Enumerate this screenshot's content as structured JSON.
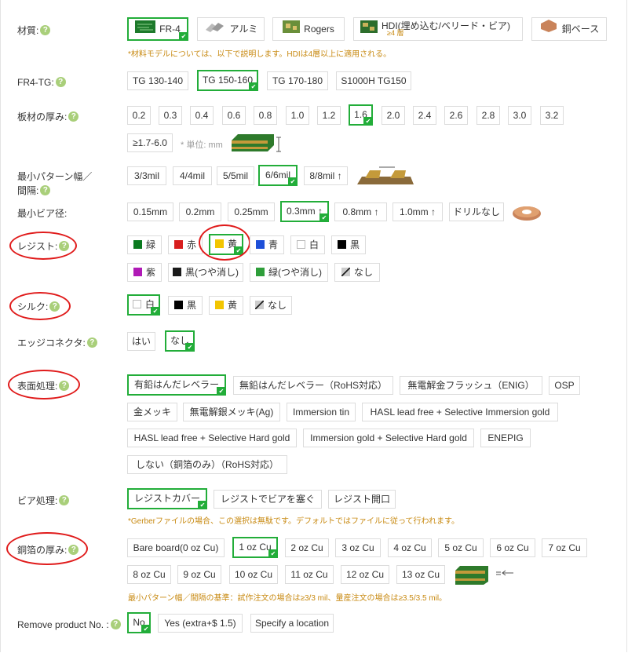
{
  "material": {
    "label": "材質:",
    "options": [
      "FR-4",
      "アルミ",
      "Rogers",
      "HDI(埋め込む/ベリード・ビア)",
      "銅ベース"
    ],
    "hdi_sub": "≥4 層",
    "selected": "FR-4",
    "note": "*材料モデルについては、以下で説明します。HDIは4層以上に適用される。"
  },
  "tg": {
    "label": "FR4-TG:",
    "options": [
      "TG 130-140",
      "TG 150-160",
      "TG 170-180",
      "S1000H TG150"
    ],
    "selected": "TG 150-160"
  },
  "thickness": {
    "label": "板材の厚み:",
    "options": [
      "0.2",
      "0.3",
      "0.4",
      "0.6",
      "0.8",
      "1.0",
      "1.2",
      "1.6",
      "2.0",
      "2.4",
      "2.6",
      "2.8",
      "3.0",
      "3.2",
      "≥1.7-6.0"
    ],
    "selected": "1.6",
    "unit": "* 単位: mm"
  },
  "pattern": {
    "label_line1": "最小パターン幅／",
    "label_line2": "間隔:",
    "options": [
      "3/3mil",
      "4/4mil",
      "5/5mil",
      "6/6mil",
      "8/8mil ↑"
    ],
    "selected": "6/6mil"
  },
  "via": {
    "label": "最小ビア径:",
    "options": [
      "0.15mm",
      "0.2mm",
      "0.25mm",
      "0.3mm ↑",
      "0.8mm ↑",
      "1.0mm ↑",
      "ドリルなし"
    ],
    "selected": "0.3mm ↑"
  },
  "resist": {
    "label": "レジスト:",
    "options": [
      {
        "text": "緑",
        "color": "#0a7a1f"
      },
      {
        "text": "赤",
        "color": "#d81e1e"
      },
      {
        "text": "黄",
        "color": "#f2c500"
      },
      {
        "text": "青",
        "color": "#1e4fd8"
      },
      {
        "text": "白",
        "color": "#ffffff"
      },
      {
        "text": "黒",
        "color": "#000000"
      },
      {
        "text": "紫",
        "color": "#b01ab6"
      },
      {
        "text": "黒(つや消し)",
        "color": "#1a1a1a"
      },
      {
        "text": "緑(つや消し)",
        "color": "#2e9e3a"
      },
      {
        "text": "なし",
        "color": "none"
      }
    ],
    "selected": "黄"
  },
  "silk": {
    "label": "シルク:",
    "options": [
      {
        "text": "白",
        "color": "#ffffff"
      },
      {
        "text": "黒",
        "color": "#000000"
      },
      {
        "text": "黄",
        "color": "#f2c500"
      },
      {
        "text": "なし",
        "color": "none"
      }
    ],
    "selected": "白"
  },
  "edge": {
    "label": "エッジコネクタ:",
    "options": [
      "はい",
      "なし"
    ],
    "selected": "なし"
  },
  "surface": {
    "label": "表面処理:",
    "options": [
      "有鉛はんだレベラー",
      "無鉛はんだレベラー（RoHS対応）",
      "無電解金フラッシュ（ENIG）",
      "OSP",
      "金メッキ",
      "無電解銀メッキ(Ag)",
      "Immersion tin",
      "HASL lead free + Selective Immersion gold",
      "HASL lead free + Selective Hard gold",
      "Immersion gold + Selective Hard gold",
      "ENEPIG",
      "しない（銅箔のみ）（RoHS対応）"
    ],
    "selected": "有鉛はんだレベラー"
  },
  "via_treat": {
    "label": "ビア処理:",
    "options": [
      "レジストカバー",
      "レジストでビアを塞ぐ",
      "レジスト開口"
    ],
    "selected": "レジストカバー",
    "note": "*Gerberファイルの場合、この選択は無駄です。デフォルトではファイルに従って行われます。"
  },
  "copper": {
    "label": "銅箔の厚み:",
    "options": [
      "Bare board(0 oz Cu)",
      "1 oz Cu",
      "2 oz Cu",
      "3 oz Cu",
      "4 oz Cu",
      "5 oz Cu",
      "6 oz Cu",
      "7 oz Cu",
      "8 oz Cu",
      "9 oz Cu",
      "10 oz Cu",
      "11 oz Cu",
      "12 oz Cu",
      "13 oz Cu"
    ],
    "selected": "1 oz Cu",
    "note": "最小パターン幅／間隔の基準：試作注文の場合は≥3/3 mil、量産注文の場合は≥3.5/3.5 mil。"
  },
  "product_no": {
    "label": "Remove product No. :",
    "options": [
      "No",
      "Yes (extra+$ 1.5)",
      "Specify a location"
    ],
    "selected": "No"
  },
  "help_icon": "question-icon",
  "colors": {
    "accent": "#22ad39",
    "note": "#c88a12",
    "highlight_ring": "#e01b1b"
  }
}
